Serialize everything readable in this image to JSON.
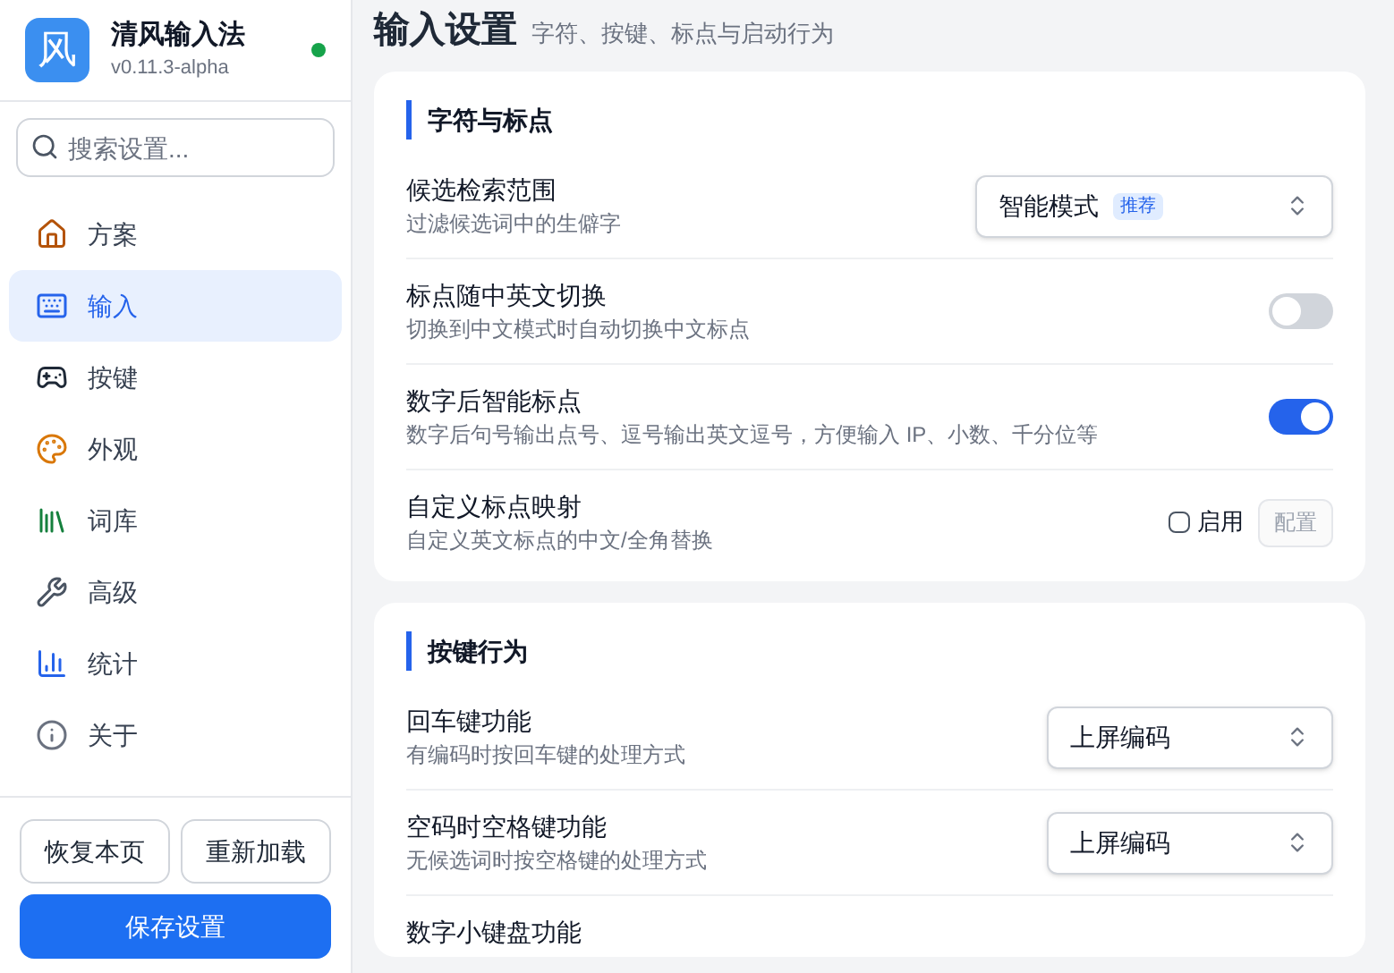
{
  "app": {
    "logo": "风",
    "name": "清风输入法",
    "version": "v0.11.3-alpha",
    "online": true
  },
  "search": {
    "placeholder": "搜索设置..."
  },
  "sidebar": {
    "items": [
      {
        "label": "方案",
        "selected": false
      },
      {
        "label": "输入",
        "selected": true
      },
      {
        "label": "按键",
        "selected": false
      },
      {
        "label": "外观",
        "selected": false
      },
      {
        "label": "词库",
        "selected": false
      },
      {
        "label": "高级",
        "selected": false
      },
      {
        "label": "统计",
        "selected": false
      },
      {
        "label": "关于",
        "selected": false
      }
    ]
  },
  "footer": {
    "buttons": [
      "恢复本页",
      "重新加载"
    ],
    "primary": "保存设置"
  },
  "page": {
    "title": "输入设置",
    "subtitle": "字符、按键、标点与启动行为"
  },
  "sections": [
    {
      "title": "字符与标点",
      "rows": [
        {
          "kind": "select",
          "label": "候选检索范围",
          "description": "过滤候选词中的生僻字",
          "value": "智能模式",
          "badge": "推荐"
        },
        {
          "kind": "toggle",
          "label": "标点随中英文切换",
          "description": "切换到中文模式时自动切换中文标点",
          "on": false
        },
        {
          "kind": "toggle",
          "label": "数字后智能标点",
          "description": "数字后句号输出点号、逗号输出英文逗号，方便输入 IP、小数、千分位等",
          "on": true
        },
        {
          "kind": "checkbox",
          "label": "自定义标点映射",
          "description": "自定义英文标点的中文/全角替换",
          "check_label": "启用",
          "checked": false,
          "button": "配置",
          "disabled": true
        }
      ]
    },
    {
      "title": "按键行为",
      "rows": [
        {
          "kind": "select",
          "label": "回车键功能",
          "description": "有编码时按回车键的处理方式",
          "value": "上屏编码"
        },
        {
          "kind": "select",
          "label": "空码时空格键功能",
          "description": "无候选词时按空格键的处理方式",
          "value": "上屏编码"
        },
        {
          "kind": "title",
          "label": "数字小键盘功能"
        }
      ]
    }
  ]
}
